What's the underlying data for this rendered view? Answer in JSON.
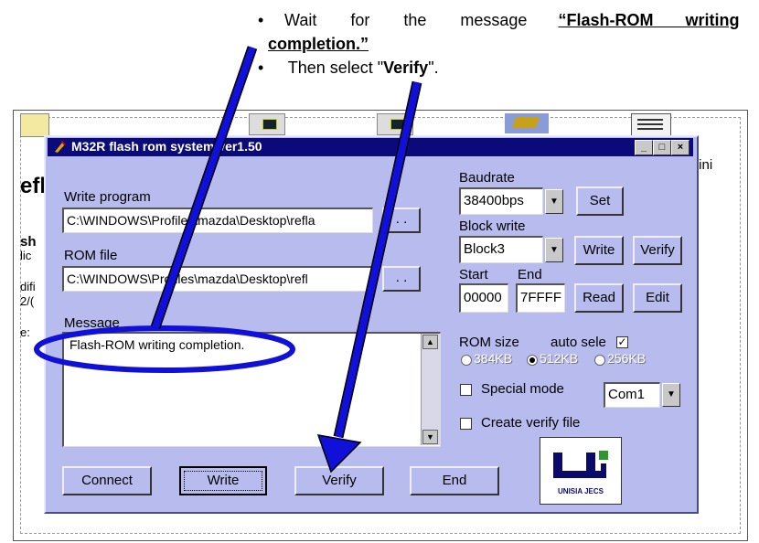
{
  "instructions": {
    "line1_prefix": "Wait for the message",
    "line1_bold": "“Flash-ROM writing",
    "line2_bold": "completion.”",
    "line3_prefix": "Then select \"",
    "line3_bold": "Verify",
    "line3_suffix": "\"."
  },
  "background_fragments": {
    "right_ini": ".ini",
    "left_big": "efl",
    "left_sh": "sh",
    "left_lic": "lic",
    "left_difi": "difi",
    "left_2o": "2/(",
    "left_e": "e:"
  },
  "window": {
    "title": "M32R flash rom system ver1.50",
    "min": "_",
    "max": "□",
    "close": "×"
  },
  "write_program": {
    "label": "Write program",
    "value": "C:\\WINDOWS\\Profiles\\mazda\\Desktop\\refla",
    "browse": ". ."
  },
  "rom_file": {
    "label": "ROM file",
    "value": "C:\\WINDOWS\\Profiles\\mazda\\Desktop\\refl",
    "browse": ". ."
  },
  "message": {
    "label": "Message",
    "text": "Flash-ROM writing completion."
  },
  "baudrate": {
    "label": "Baudrate",
    "value": "38400bps",
    "set_button": "Set"
  },
  "block_write": {
    "label": "Block write",
    "value": "Block3",
    "write_button": "Write",
    "verify_button": "Verify"
  },
  "range": {
    "start_label": "Start",
    "end_label": "End",
    "start_value": "00000",
    "end_value": "7FFFF",
    "read_button": "Read",
    "edit_button": "Edit"
  },
  "rom_size": {
    "label": "ROM size",
    "auto_select_label": "auto sele",
    "auto_select_checked": true,
    "options": [
      "384KB",
      "512KB",
      "256KB"
    ],
    "selected": "512KB"
  },
  "special_mode": {
    "label": "Special mode",
    "checked": false,
    "port": "Com1"
  },
  "create_verify": {
    "label": "Create verify file",
    "checked": false
  },
  "bottom_buttons": {
    "connect": "Connect",
    "write": "Write",
    "verify": "Verify",
    "end": "End"
  },
  "logo": {
    "text": "UNISIA JECS"
  },
  "colors": {
    "dialog_bg": "#b7bbee",
    "titlebar": "#0a0a7a",
    "annotation": "#1010d8"
  }
}
